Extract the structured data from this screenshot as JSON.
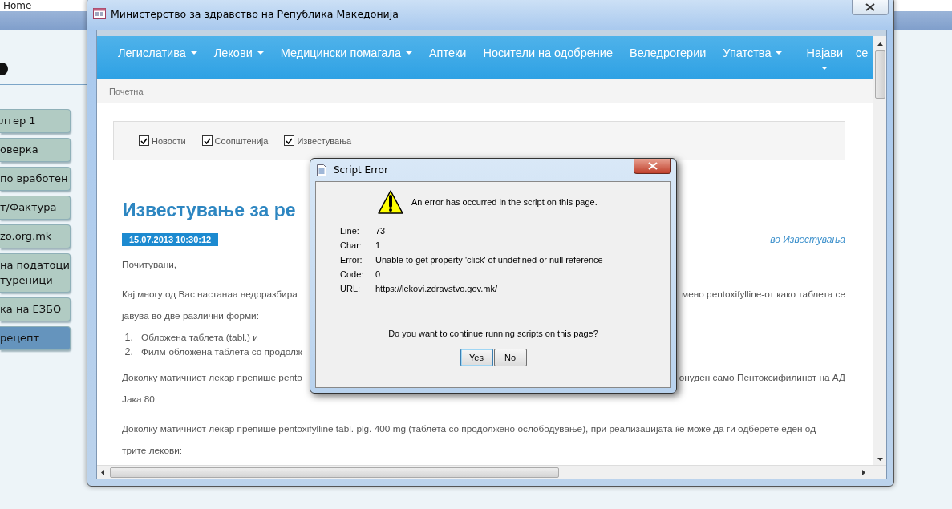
{
  "background_app": {
    "title": "Home",
    "sidebar": [
      {
        "lines": [
          "лтер 1"
        ],
        "selected": false
      },
      {
        "lines": [
          "оверка"
        ],
        "selected": false
      },
      {
        "lines": [
          "по вработен"
        ],
        "selected": false
      },
      {
        "lines": [
          "т/Фактура"
        ],
        "selected": false
      },
      {
        "lines": [
          "zo.org.mk"
        ],
        "selected": false
      },
      {
        "lines": [
          "на податоци",
          "туреници"
        ],
        "selected": false
      },
      {
        "lines": [
          "ка на ЕЗБО"
        ],
        "selected": false
      },
      {
        "lines": [
          "рецепт"
        ],
        "selected": true
      }
    ]
  },
  "window": {
    "title": "Министерство за здравство на Република  Македонија",
    "nav": [
      {
        "label": "Легислатива",
        "dropdown": true
      },
      {
        "label": "Лекови",
        "dropdown": true
      },
      {
        "label": "Медицински помагала",
        "dropdown": true
      },
      {
        "label": "Аптеки",
        "dropdown": false
      },
      {
        "label": "Носители на одобрение",
        "dropdown": false
      },
      {
        "label": "Веледрогерии",
        "dropdown": false
      },
      {
        "label": "Упатства",
        "dropdown": true
      },
      {
        "label": "Најави",
        "dropdown": true
      },
      {
        "label": "се",
        "dropdown": false
      }
    ],
    "breadcrumb": "Почетна",
    "filters": [
      {
        "label": "Новости",
        "checked": true
      },
      {
        "label": "Соопштенија",
        "checked": true
      },
      {
        "label": "Известувања",
        "checked": true
      }
    ],
    "article": {
      "title": "Известување за ре",
      "date": "15.07.2013 10:30:12",
      "category": "во Известувања",
      "blocks": [
        {
          "kind": "para",
          "lines": [
            [
              "Почитувани,"
            ]
          ]
        },
        {
          "kind": "para",
          "lines": [
            [
              "Кај многу од Вас настанаа недоразбира",
              "мено pentoxifylline-от како таблета се"
            ],
            [
              "јавува во две различни форми:"
            ]
          ]
        },
        {
          "kind": "list",
          "items": [
            {
              "number": "1.",
              "text": "Обложена таблета (tabl.) и"
            },
            {
              "number": "2.",
              "text": "Филм-обложена таблета со продолж"
            }
          ]
        },
        {
          "kind": "para",
          "lines": [
            [
              "Доколку матичниот лекар препише pento",
              "онуден само Пентоксифилинот на АД"
            ],
            [
              "Јака 80"
            ]
          ]
        },
        {
          "kind": "para",
          "lines": [
            [
              "Доколку матичниот лекар препише pentoxifylline tabl. plg. 400 mg (таблета со продолжено ослободување), при реализацијата ќе може да ги одберете еден од"
            ],
            [
              "трите лекови:"
            ]
          ]
        }
      ]
    }
  },
  "dialog": {
    "title": "Script Error",
    "message": "An error has occurred in the script on this page.",
    "details": [
      {
        "label": "Line:",
        "value": "73"
      },
      {
        "label": "Char:",
        "value": "1"
      },
      {
        "label": "Error:",
        "value": "Unable to get property 'click' of undefined or null reference"
      },
      {
        "label": "Code:",
        "value": "0"
      },
      {
        "label": "URL:",
        "value": "https://lekovi.zdravstvo.gov.mk/"
      }
    ],
    "question": "Do you want to continue running scripts on this page?",
    "buttons": [
      {
        "label": "Yes",
        "selected": true
      },
      {
        "label": "No",
        "selected": false
      }
    ]
  }
}
